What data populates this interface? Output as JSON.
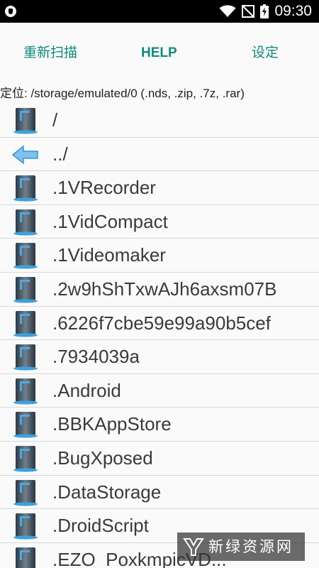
{
  "status_bar": {
    "time": "09:30",
    "icons": [
      "shield-icon",
      "wifi-icon",
      "no-signal-icon",
      "battery-charging-icon"
    ]
  },
  "toolbar": {
    "rescan_label": "重新扫描",
    "help_label": "HELP",
    "settings_label": "设定"
  },
  "location": {
    "text": "定位: /storage/emulated/0 (.nds, .zip, .7z, .rar)"
  },
  "file_list": {
    "items": [
      {
        "label": "/",
        "icon": "folder-icon"
      },
      {
        "label": "../",
        "icon": "back-arrow-icon"
      },
      {
        "label": ".1VRecorder",
        "icon": "folder-icon"
      },
      {
        "label": ".1VidCompact",
        "icon": "folder-icon"
      },
      {
        "label": ".1Videomaker",
        "icon": "folder-icon"
      },
      {
        "label": ".2w9hShTxwAJh6axsm07B",
        "icon": "folder-icon"
      },
      {
        "label": ".6226f7cbe59e99a90b5cef",
        "icon": "folder-icon"
      },
      {
        "label": ".7934039a",
        "icon": "folder-icon"
      },
      {
        "label": ".Android",
        "icon": "folder-icon"
      },
      {
        "label": ".BBKAppStore",
        "icon": "folder-icon"
      },
      {
        "label": ".BugXposed",
        "icon": "folder-icon"
      },
      {
        "label": ".DataStorage",
        "icon": "folder-icon"
      },
      {
        "label": ".DroidScript",
        "icon": "folder-icon"
      },
      {
        "label": ".EZO_PoxkmpicVD...",
        "icon": "folder-icon"
      }
    ]
  },
  "watermark": {
    "text": "新绿资源网"
  },
  "colors": {
    "accent": "#0e8a7e",
    "status_bar": "#000000",
    "background": "#fafafa",
    "divider": "#d8d8d8"
  }
}
